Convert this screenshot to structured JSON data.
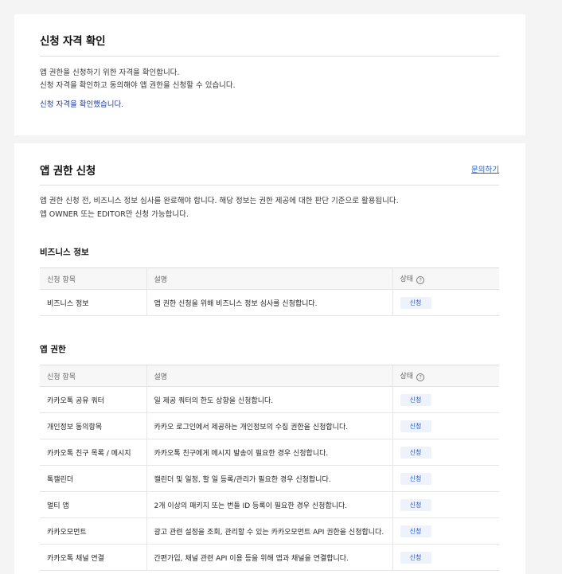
{
  "eligibility": {
    "title": "신청 자격 확인",
    "desc_line1": "앱 권한을 신청하기 위한 자격을 확인합니다.",
    "desc_line2": "신청 자격을 확인하고 동의해야 앱 권한을 신청할 수 있습니다.",
    "status_text": "신청 자격을 확인했습니다."
  },
  "permission": {
    "title": "앱 권한 신청",
    "contact_link": "문의하기",
    "desc_line1": "앱 권한 신청 전, 비즈니스 정보 심사를 완료해야 합니다. 해당 정보는 권한 제공에 대한 판단 기준으로 활용됩니다.",
    "desc_line2": "앱 OWNER 또는 EDITOR만 신청 가능합니다.",
    "columns": {
      "item": "신청 항목",
      "description": "설명",
      "status": "상태"
    },
    "status_info_icon": "info-circle-icon",
    "business": {
      "title": "비즈니스 정보",
      "rows": [
        {
          "item": "비즈니스 정보",
          "description": "앱 권한 신청을 위해 비즈니스 정보 심사를 신청합니다.",
          "action": "신청"
        }
      ]
    },
    "app": {
      "title": "앱 권한",
      "rows": [
        {
          "item": "카카오톡 공유 쿼터",
          "description": "일 제공 쿼터의 한도 상향을 신청합니다.",
          "action": "신청"
        },
        {
          "item": "개인정보 동의항목",
          "description": "카카오 로그인에서 제공하는 개인정보의 수집 권한을 신청합니다.",
          "action": "신청"
        },
        {
          "item": "카카오톡 친구 목록 / 메시지",
          "description": "카카오톡 친구에게 메시지 발송이 필요한 경우 신청합니다.",
          "action": "신청"
        },
        {
          "item": "톡캘린더",
          "description": "캘린더 및 일정, 할 일 등록/관리가 필요한 경우 신청합니다.",
          "action": "신청"
        },
        {
          "item": "멀티 앱",
          "description": "2개 이상의 패키지 또는 번들 ID 등록이 필요한 경우 신청합니다.",
          "action": "신청"
        },
        {
          "item": "카카오모먼트",
          "description": "광고 관련 설정을 조회, 관리할 수 있는 카카오모먼트 API 권한을 신청합니다.",
          "action": "신청"
        },
        {
          "item": "카카오톡 채널 연결",
          "description": "간편가입, 채널 관련 API 이용 등을 위해 앱과 채널을 연결합니다.",
          "action": "신청"
        }
      ]
    }
  }
}
